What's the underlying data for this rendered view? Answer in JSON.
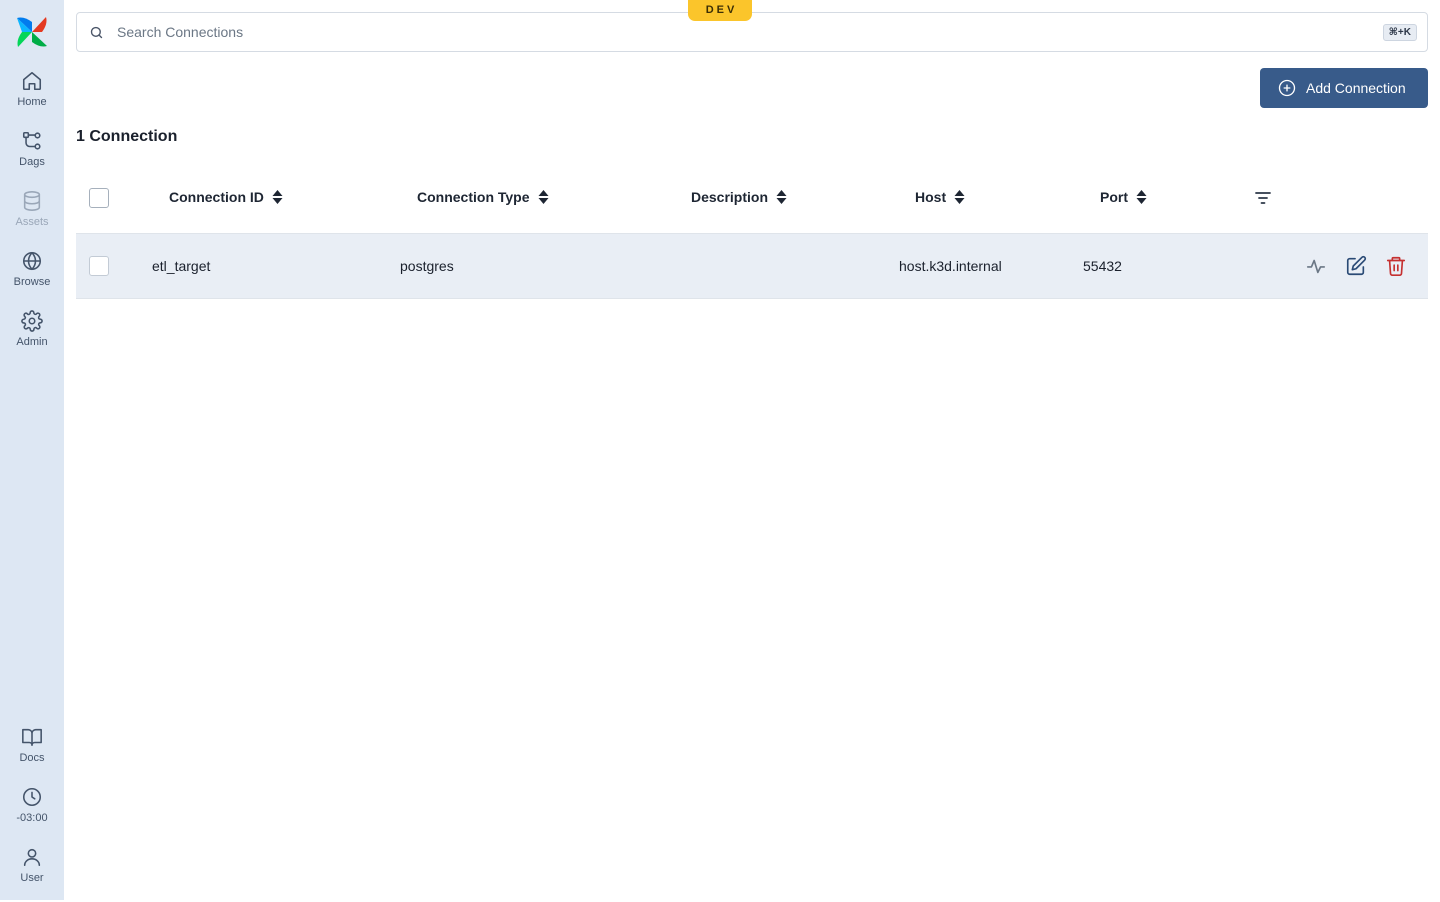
{
  "environment_badge": "DEV",
  "nav": {
    "top": [
      {
        "label": "Home",
        "icon": "home-icon"
      },
      {
        "label": "Dags",
        "icon": "dags-icon"
      },
      {
        "label": "Assets",
        "icon": "database-icon",
        "disabled": true
      },
      {
        "label": "Browse",
        "icon": "globe-icon"
      },
      {
        "label": "Admin",
        "icon": "gear-icon"
      }
    ],
    "bottom": [
      {
        "label": "Docs",
        "icon": "book-icon"
      },
      {
        "label": "-03:00",
        "icon": "clock-icon"
      },
      {
        "label": "User",
        "icon": "user-icon"
      }
    ]
  },
  "search": {
    "placeholder": "Search Connections",
    "value": "",
    "shortcut": "⌘+K"
  },
  "toolbar": {
    "add_label": "Add Connection"
  },
  "summary": {
    "count_label": "1 Connection"
  },
  "table": {
    "columns": [
      "Connection ID",
      "Connection Type",
      "Description",
      "Host",
      "Port"
    ],
    "rows": [
      {
        "connection_id": "etl_target",
        "connection_type": "postgres",
        "description": "",
        "host": "host.k3d.internal",
        "port": "55432"
      }
    ]
  },
  "colors": {
    "sidebar_bg": "#dde7f3",
    "primary_button": "#385b8a",
    "badge": "#fbc52b",
    "row_bg": "#e9eef5",
    "delete_icon": "#c53030"
  }
}
